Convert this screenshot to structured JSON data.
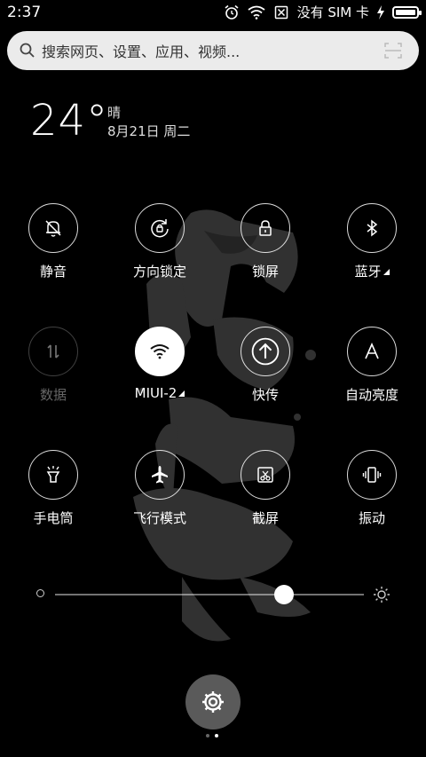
{
  "status_bar": {
    "time": "2:37",
    "sim_text": "没有 SIM 卡",
    "battery_level": 1.0,
    "icons": [
      "alarm-icon",
      "wifi-icon",
      "no-sim-icon",
      "charging-icon",
      "battery-icon"
    ]
  },
  "search": {
    "placeholder": "搜索网页、设置、应用、视频..."
  },
  "weather": {
    "temperature": "24°",
    "condition": "晴",
    "date": "8月21日 周二"
  },
  "toggles": [
    {
      "label": "静音",
      "icon": "bell-off-icon",
      "state": "off"
    },
    {
      "label": "方向锁定",
      "icon": "rotation-lock-icon",
      "state": "off"
    },
    {
      "label": "锁屏",
      "icon": "lock-icon",
      "state": "off"
    },
    {
      "label": "蓝牙",
      "icon": "bluetooth-icon",
      "state": "off",
      "expandable": true
    },
    {
      "label": "数据",
      "icon": "data-arrows-icon",
      "state": "disabled"
    },
    {
      "label": "MIUI-2",
      "icon": "wifi-icon",
      "state": "on",
      "expandable": true
    },
    {
      "label": "快传",
      "icon": "upload-circle-icon",
      "state": "off"
    },
    {
      "label": "自动亮度",
      "icon": "auto-brightness-icon",
      "state": "off"
    },
    {
      "label": "手电筒",
      "icon": "flashlight-icon",
      "state": "off"
    },
    {
      "label": "飞行模式",
      "icon": "airplane-icon",
      "state": "off"
    },
    {
      "label": "截屏",
      "icon": "screenshot-icon",
      "state": "off"
    },
    {
      "label": "振动",
      "icon": "vibrate-icon",
      "state": "off"
    }
  ],
  "brightness": {
    "level": 0.74
  },
  "pager": {
    "pages": 2,
    "current": 2
  },
  "colors": {
    "background": "#000000",
    "search_bg": "#ebebeb",
    "active_toggle": "#ffffff",
    "settings_button": "#5a5a5a"
  }
}
